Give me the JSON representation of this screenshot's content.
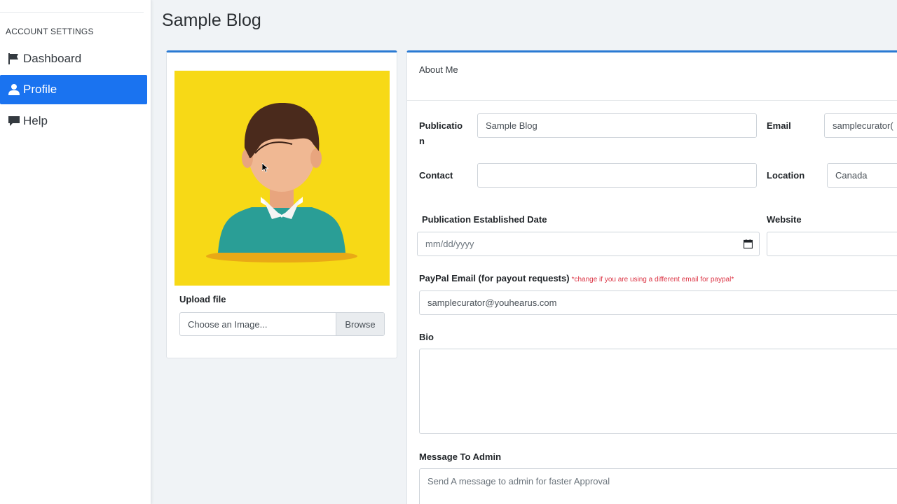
{
  "sidebar": {
    "section_title": "ACCOUNT SETTINGS",
    "items": [
      {
        "label": "Dashboard",
        "icon": "flag-icon"
      },
      {
        "label": "Profile",
        "icon": "user-icon",
        "active": true
      },
      {
        "label": "Help",
        "icon": "comment-icon"
      }
    ],
    "active_color": "#1a73f0"
  },
  "page": {
    "title": "Sample Blog"
  },
  "avatar_card": {
    "upload_label": "Upload file",
    "file_placeholder": "Choose an Image...",
    "browse_label": "Browse",
    "accent_color": "#2a7ad3",
    "avatar_bg": "#f7d916"
  },
  "about": {
    "header": "About Me",
    "publication_label_line1": "Publicatio",
    "publication_label_line2": "n",
    "publication_value": "Sample Blog",
    "email_label": "Email",
    "email_value": "samplecurator(",
    "contact_label": "Contact",
    "contact_value": "",
    "location_label": "Location",
    "location_value": "Canada",
    "established_label": "Publication Established Date",
    "established_placeholder": "mm/dd/yyyy",
    "website_label": "Website",
    "website_value": "",
    "paypal_label": "PayPal Email (for payout requests)",
    "paypal_hint": "*change if you are using a different email for paypal*",
    "paypal_value": "samplecurator@youhearus.com",
    "bio_label": "Bio",
    "bio_value": "",
    "message_label": "Message To Admin",
    "message_placeholder": "Send A message to admin for faster Approval"
  }
}
